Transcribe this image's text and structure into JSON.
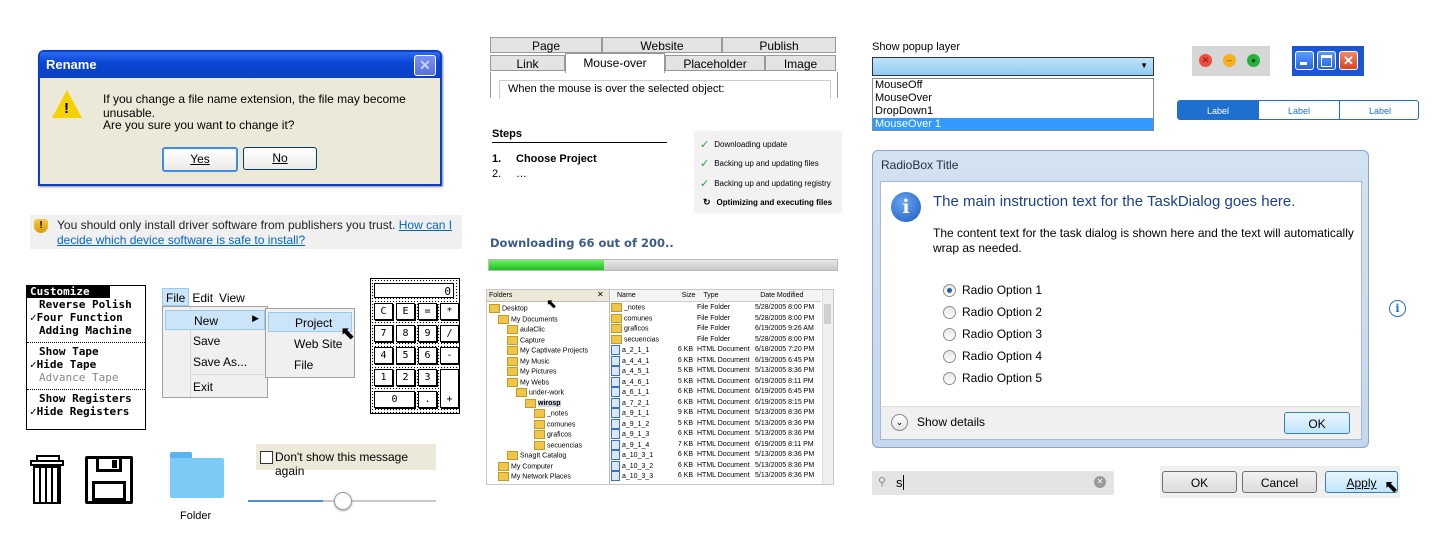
{
  "rename_dialog": {
    "title": "Rename",
    "line1": "If you change a file name extension, the file may become unusable.",
    "line2": "Are you sure you want to change it?",
    "yes": "Yes",
    "no": "No"
  },
  "driver_warning": {
    "text": "You should only install driver software from publishers you trust.",
    "link": "How can I decide which device software is safe to install?"
  },
  "mac_menu": {
    "title": "Customize",
    "items": [
      "Reverse Polish",
      "✓Four Function",
      "Adding Machine",
      "Show Tape",
      "✓Hide Tape",
      "Advance Tape",
      "Show Registers",
      "✓Hide Registers"
    ]
  },
  "win_menu": {
    "bar": [
      "File",
      "Edit",
      "View"
    ],
    "items": [
      "New",
      "Save",
      "Save As...",
      "Exit"
    ],
    "submenu": [
      "Project",
      "Web Site",
      "File"
    ]
  },
  "calculator": {
    "display": "0",
    "keys": [
      "C",
      "E",
      "=",
      "*",
      "7",
      "8",
      "9",
      "/",
      "4",
      "5",
      "6",
      "-",
      "1",
      "2",
      "3",
      "+",
      "0",
      "."
    ]
  },
  "desktop_icons": {
    "folder_label": "Folder"
  },
  "dont_show": {
    "label": "Don't show this message again"
  },
  "slider": {
    "value_percent": 40
  },
  "tabs_dialog": {
    "row1": [
      "Page",
      "Website",
      "Publish"
    ],
    "row2": [
      "Link",
      "Mouse-over",
      "Placeholder",
      "Image"
    ],
    "content": "When the mouse is over the selected object:"
  },
  "steps": {
    "heading": "Steps",
    "item1_num": "1.",
    "item1": "Choose Project",
    "item2_num": "2.",
    "item2": "…"
  },
  "progress_steps": [
    "Downloading update",
    "Backing up and updating files",
    "Backing up and updating registry",
    "Optimizing and executing files"
  ],
  "download": {
    "label": "Downloading 66 out of 200..",
    "progress_percent": 33
  },
  "explorer": {
    "folders_label": "Folders",
    "tree": [
      "Desktop",
      "My Documents",
      "aulaClic",
      "Capture",
      "My Captivate Projects",
      "My Music",
      "My Pictures",
      "My Webs",
      "under-work",
      "wirosp",
      "_notes",
      "comunes",
      "graficos",
      "secuencias",
      "SnagIt Catalog",
      "My Computer",
      "My Network Places"
    ],
    "columns": [
      "Name",
      "Size",
      "Type",
      "Date Modified"
    ],
    "files": [
      [
        "_notes",
        "",
        "File Folder",
        "5/28/2005 8:00 PM"
      ],
      [
        "comunes",
        "",
        "File Folder",
        "5/28/2005 8:00 PM"
      ],
      [
        "graficos",
        "",
        "File Folder",
        "6/19/2005 9:26 AM"
      ],
      [
        "secuencias",
        "",
        "File Folder",
        "5/28/2005 8:00 PM"
      ],
      [
        "a_2_1_1",
        "6 KB",
        "HTML Document",
        "6/18/2005 7:20 PM"
      ],
      [
        "a_4_4_1",
        "6 KB",
        "HTML Document",
        "6/19/2005 6:45 PM"
      ],
      [
        "a_4_5_1",
        "5 KB",
        "HTML Document",
        "5/13/2005 8:36 PM"
      ],
      [
        "a_4_6_1",
        "5 KB",
        "HTML Document",
        "6/19/2005 8:11 PM"
      ],
      [
        "a_6_1_1",
        "6 KB",
        "HTML Document",
        "6/19/2005 6:45 PM"
      ],
      [
        "a_7_2_1",
        "6 KB",
        "HTML Document",
        "6/19/2005 8:15 PM"
      ],
      [
        "a_9_1_1",
        "9 KB",
        "HTML Document",
        "5/13/2005 8:36 PM"
      ],
      [
        "a_9_1_2",
        "5 KB",
        "HTML Document",
        "5/13/2005 8:36 PM"
      ],
      [
        "a_9_1_3",
        "6 KB",
        "HTML Document",
        "5/13/2005 8:36 PM"
      ],
      [
        "a_9_1_4",
        "7 KB",
        "HTML Document",
        "6/19/2005 8:11 PM"
      ],
      [
        "a_10_3_1",
        "6 KB",
        "HTML Document",
        "5/13/2005 8:36 PM"
      ],
      [
        "a_10_3_2",
        "6 KB",
        "HTML Document",
        "5/13/2005 8:36 PM"
      ],
      [
        "a_10_3_3",
        "6 KB",
        "HTML Document",
        "5/13/2005 8:36 PM"
      ]
    ]
  },
  "popup_layer": {
    "label": "Show popup layer",
    "options": [
      "MouseOff",
      "MouseOver",
      "DropDown1",
      "MouseOver 1"
    ]
  },
  "segmented": [
    "Label",
    "Label",
    "Label"
  ],
  "task_dialog": {
    "title": "RadioBox Title",
    "main_instruction": "The main instruction text for the TaskDialog goes here.",
    "content": "The content text for the task dialog is shown here and the text will automatically wrap as needed.",
    "radios": [
      "Radio Option 1",
      "Radio Option 2",
      "Radio Option 3",
      "Radio Option 4",
      "Radio Option 5"
    ],
    "show_details": "Show details",
    "ok": "OK"
  },
  "search": {
    "value": "s"
  },
  "buttons": {
    "ok": "OK",
    "cancel": "Cancel",
    "apply": "Apply"
  },
  "colors": {
    "xp_blue": "#0a47d6",
    "win7_blue": "#1f6fd1",
    "progress_green": "#22c22e",
    "selection_blue": "#3399ff"
  }
}
